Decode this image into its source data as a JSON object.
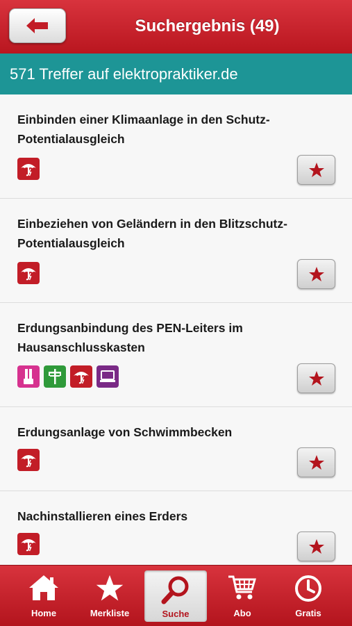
{
  "header": {
    "title": "Suchergebnis (49)"
  },
  "subheader": {
    "text": "571 Treffer auf elektropraktiker.de"
  },
  "results": [
    {
      "title": "Einbinden einer Klimaanlage in den Schutz-Potentialausgleich",
      "icons": [
        "umbrella-lightning-icon"
      ]
    },
    {
      "title": "Einbeziehen von Geländern in den Blitzschutz-Potentialausgleich",
      "icons": [
        "umbrella-lightning-icon"
      ]
    },
    {
      "title": "Erdungsanbindung des PEN-Leiters im Hausanschlusskasten",
      "icons": [
        "probe-icon",
        "power-pole-icon",
        "umbrella-lightning-icon",
        "laptop-icon"
      ]
    },
    {
      "title": "Erdungsanlage von Schwimmbecken",
      "icons": [
        "umbrella-lightning-icon"
      ]
    },
    {
      "title": "Nachinstallieren eines Erders",
      "icons": [
        "umbrella-lightning-icon"
      ]
    }
  ],
  "tabs": {
    "home": "Home",
    "merkliste": "Merkliste",
    "suche": "Suche",
    "abo": "Abo",
    "gratis": "Gratis"
  },
  "colors": {
    "header": "#c8222b",
    "subheader": "#1d9596",
    "accent": "#b3141d"
  }
}
